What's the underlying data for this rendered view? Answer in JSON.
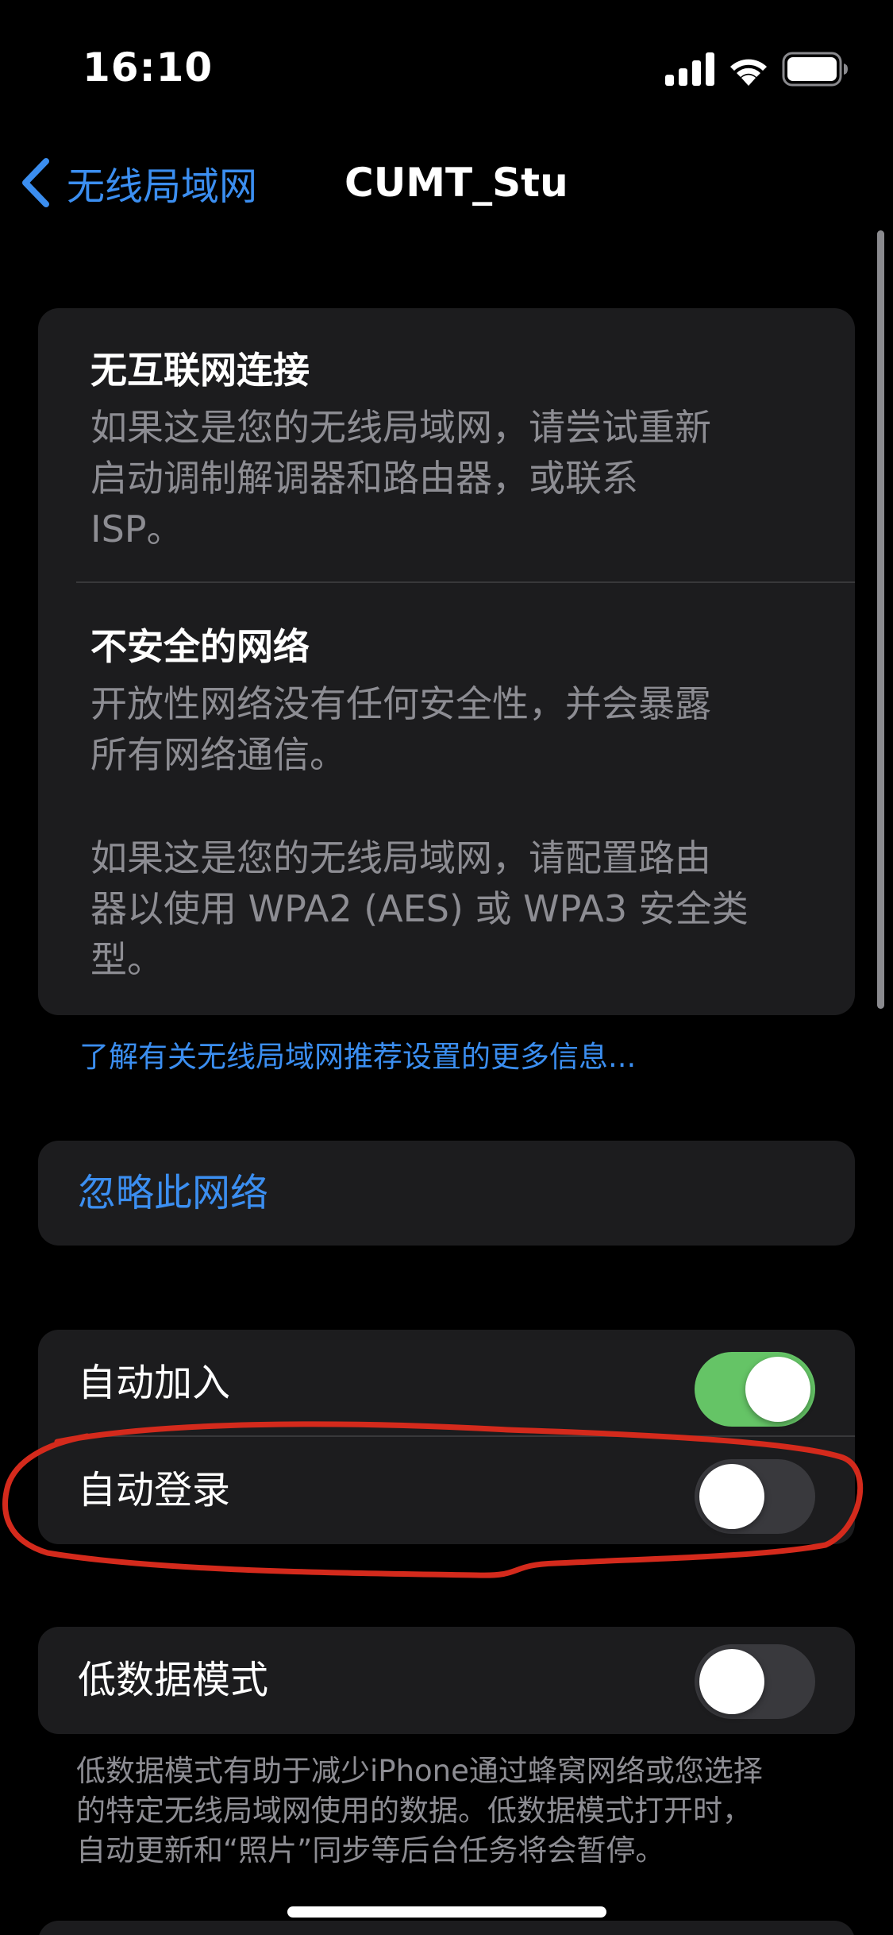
{
  "status_bar": {
    "time": "16:10",
    "icons": [
      "cellular-signal-icon",
      "wifi-icon",
      "battery-icon"
    ]
  },
  "nav": {
    "back_label": "无线局域网",
    "title": "CUMT_Stu",
    "accent_color": "#3b8ef0"
  },
  "warnings": {
    "no_internet": {
      "title": "无互联网连接",
      "body_lines": [
        "如果这是您的无线局域网，请尝试重新",
        "启动调制解调器和路由器，或联系",
        "ISP。"
      ]
    },
    "insecure": {
      "title": "不安全的网络",
      "body1_lines": [
        "开放性网络没有任何安全性，并会暴露",
        "所有网络通信。"
      ],
      "body2_lines": [
        "如果这是您的无线局域网，请配置路由",
        "器以使用 WPA2 (AES) 或 WPA3 安全类",
        "型。"
      ]
    }
  },
  "more_info_link": "了解有关无线局域网推荐设置的更多信息...",
  "forget_network": "忽略此网络",
  "toggles": {
    "auto_join": {
      "label": "自动加入",
      "on": true
    },
    "auto_login": {
      "label": "自动登录",
      "on": false
    }
  },
  "low_data_mode": {
    "label": "低数据模式",
    "on": false,
    "footer_lines": [
      "低数据模式有助于减少iPhone通过蜂窝网络或您选择",
      "的特定无线局域网使用的数据。低数据模式打开时，",
      "自动更新和“照片”同步等后台任务将会暂停。"
    ]
  },
  "colors": {
    "background": "#000000",
    "card": "#1c1c1e",
    "switch_on": "#65c466",
    "switch_off": "#39393d",
    "secondary_text": "#8d8d93",
    "annotation": "#d42a1c"
  }
}
